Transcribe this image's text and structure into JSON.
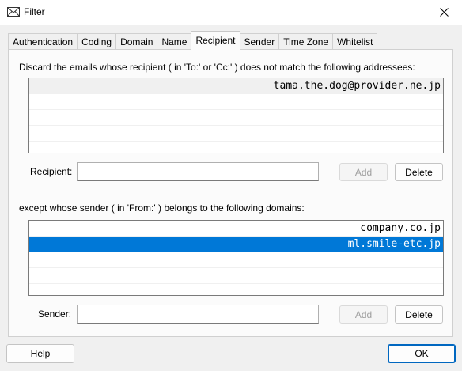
{
  "window": {
    "title": "Filter",
    "icon": "envelope-icon",
    "close_icon": "close-icon"
  },
  "tabs": [
    {
      "label": "Authentication",
      "active": false
    },
    {
      "label": "Coding",
      "active": false
    },
    {
      "label": "Domain",
      "active": false
    },
    {
      "label": "Name",
      "active": false
    },
    {
      "label": "Recipient",
      "active": true
    },
    {
      "label": "Sender",
      "active": false
    },
    {
      "label": "Time Zone",
      "active": false
    },
    {
      "label": "Whitelist",
      "active": false
    }
  ],
  "recipient_section": {
    "description": "Discard the emails whose recipient ( in 'To:' or 'Cc:' ) does not match the following addressees:",
    "list_items": [
      "tama.the.dog@provider.ne.jp"
    ],
    "field_label": "Recipient:",
    "field_value": "",
    "add_label": "Add",
    "delete_label": "Delete"
  },
  "sender_section": {
    "description": "except whose sender ( in 'From:' ) belongs to the following domains:",
    "list_items": [
      "company.co.jp",
      "ml.smile-etc.jp"
    ],
    "selected_item": "ml.smile-etc.jp",
    "field_label": "Sender:",
    "field_value": "",
    "add_label": "Add",
    "delete_label": "Delete"
  },
  "footer": {
    "help_label": "Help",
    "ok_label": "OK"
  },
  "colors": {
    "selection": "#0078d7",
    "default_button_border": "#0067c0"
  }
}
